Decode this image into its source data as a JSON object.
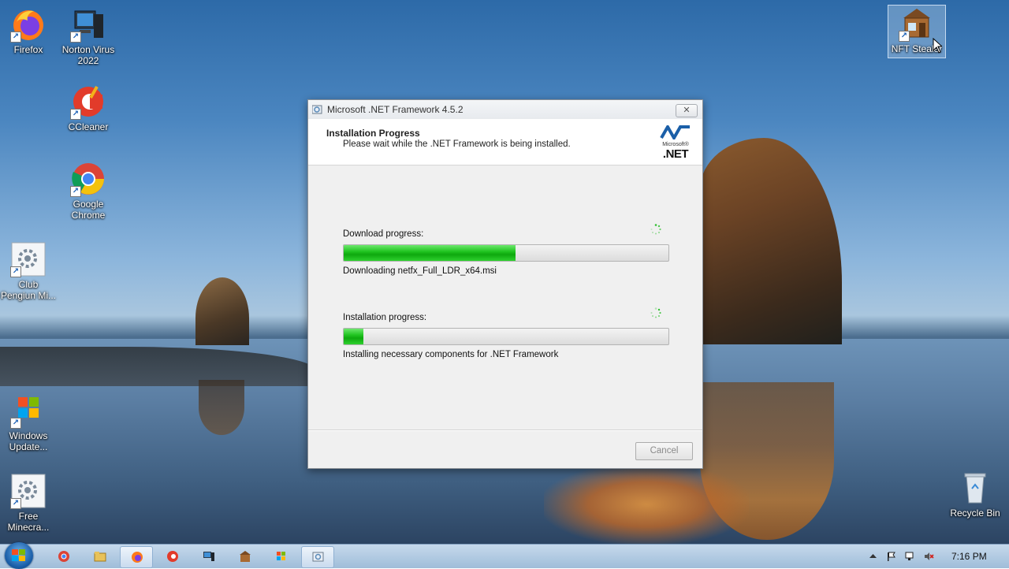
{
  "desktop": {
    "icons": [
      {
        "label": "Firefox"
      },
      {
        "label": "Norton Virus 2022"
      },
      {
        "label": "CCleaner"
      },
      {
        "label": "Google Chrome"
      },
      {
        "label": "Club Pengiun Mi..."
      },
      {
        "label": "Windows Update..."
      },
      {
        "label": "Free Minecra..."
      },
      {
        "label": "NFT Stealer"
      },
      {
        "label": "Recycle Bin"
      }
    ]
  },
  "dialog": {
    "title": "Microsoft .NET Framework 4.5.2",
    "close_label": "✕",
    "header_title": "Installation Progress",
    "header_subtitle": "Please wait while the .NET Framework is being installed.",
    "logo_microsoft": "Microsoft®",
    "logo_net": ".NET",
    "download": {
      "label": "Download progress:",
      "progress": 0.53,
      "status": "Downloading netfx_Full_LDR_x64.msi"
    },
    "install": {
      "label": "Installation progress:",
      "progress": 0.06,
      "status": "Installing necessary components for .NET Framework"
    },
    "cancel_label": "Cancel"
  },
  "taskbar": {
    "clock": "7:16 PM",
    "items": [
      "chrome",
      "explorer",
      "firefox",
      "ccleaner",
      "norton",
      "nft-stealer",
      "windows-update",
      "dotnet-installer"
    ]
  },
  "colors": {
    "progress_green": "#22c522",
    "dialog_bg": "#f0f0f0"
  }
}
